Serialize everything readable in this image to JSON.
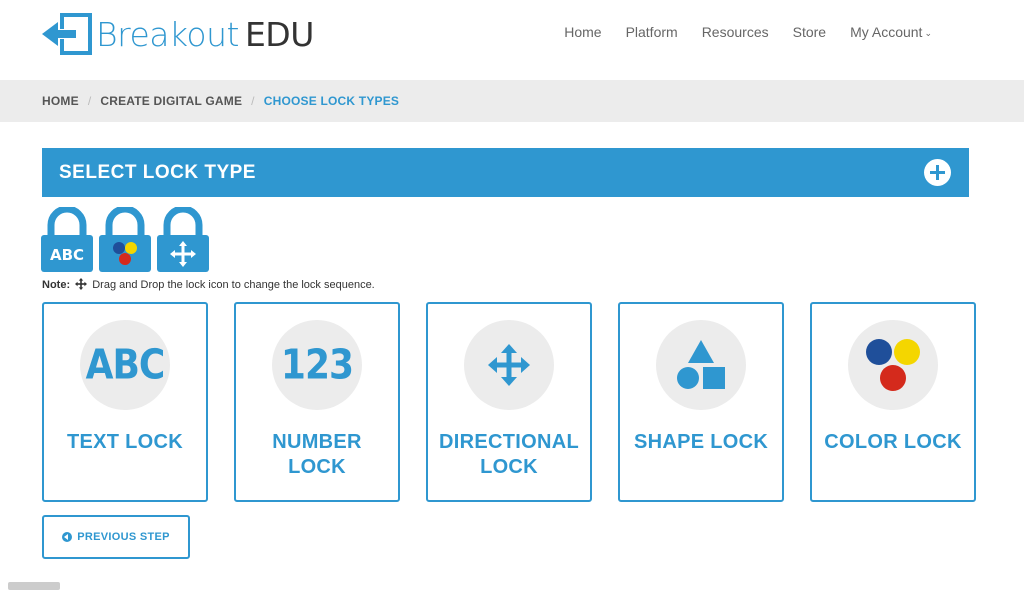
{
  "header": {
    "logo_brand": "Breakout",
    "logo_suffix": "EDU",
    "nav": {
      "home": "Home",
      "platform": "Platform",
      "resources": "Resources",
      "store": "Store",
      "account": "My Account"
    }
  },
  "breadcrumb": {
    "items": [
      "HOME",
      "CREATE DIGITAL GAME",
      "CHOOSE LOCK TYPES"
    ],
    "separator": "/"
  },
  "section": {
    "title": "SELECT LOCK TYPE"
  },
  "sequence": {
    "locks": [
      {
        "type": "text",
        "icon": "abc-lock-icon",
        "text": "ABC"
      },
      {
        "type": "color",
        "icon": "color-lock-icon"
      },
      {
        "type": "directional",
        "icon": "directional-lock-icon"
      }
    ]
  },
  "note": {
    "label": "Note:",
    "text": "Drag and Drop the lock icon to change the lock sequence."
  },
  "cards": [
    {
      "label_1": "TEXT LOCK",
      "label_2": "",
      "glyph": "ABC",
      "icon": "abc-icon"
    },
    {
      "label_1": "NUMBER",
      "label_2": "LOCK",
      "glyph": "123",
      "icon": "number-icon"
    },
    {
      "label_1": "DIRECTIONAL",
      "label_2": "LOCK",
      "icon": "arrows-icon"
    },
    {
      "label_1": "SHAPE LOCK",
      "label_2": "",
      "icon": "shapes-icon"
    },
    {
      "label_1": "COLOR LOCK",
      "label_2": "",
      "icon": "color-circles-icon"
    }
  ],
  "buttons": {
    "previous_step": "PREVIOUS STEP"
  },
  "colors": {
    "accent": "#2f97d0",
    "breadcrumb_bg": "#ececec",
    "color_blue": "#1f6fb8",
    "color_yellow": "#f4d600",
    "color_red": "#d42a1c"
  }
}
